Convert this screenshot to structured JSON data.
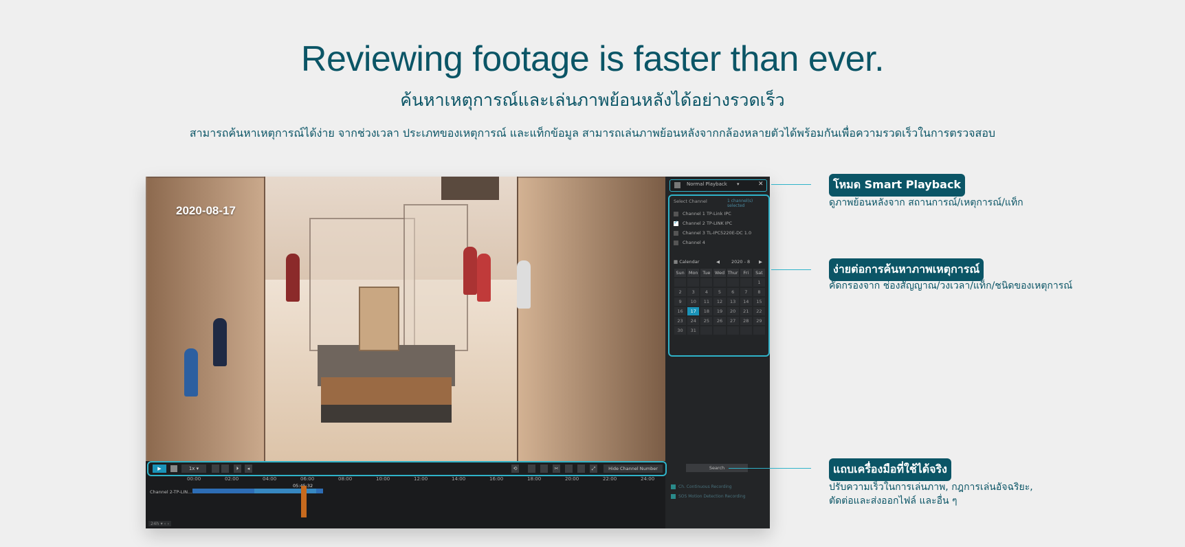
{
  "hero": {
    "title": "Reviewing footage is faster than ever.",
    "subtitle": "ค้นหาเหตุการณ์และเล่นภาพย้อนหลังได้อย่างรวดเร็ว",
    "description": "สามารถค้นหาเหตุการณ์ได้ง่าย จากช่วงเวลา ประเภทของเหตุการณ์ และแท็กข้อมูล สามารถเล่นภาพย้อนหลังจากกล้องหลายตัวได้พร้อมกันเพื่อความรวดเร็วในการตรวจสอบ"
  },
  "screenshot": {
    "video_date": "2020-08-17",
    "playback_mode": "Normal Playback",
    "channel_header": "Select Channel",
    "channel_count": "1 channel(s) selected",
    "channels": [
      {
        "label": "Channel 1 TP-Link IPC",
        "checked": false
      },
      {
        "label": "Channel 2 TP-LINK IPC",
        "checked": true
      },
      {
        "label": "Channel 3 TL-IPC5220E-DC 1.0",
        "checked": false
      },
      {
        "label": "Channel 4",
        "checked": false
      }
    ],
    "calendar_label": "Calendar",
    "calendar_month": "2020 - 8",
    "weekdays": [
      "Sun",
      "Mon",
      "Tue",
      "Wed",
      "Thur",
      "Fri",
      "Sat"
    ],
    "calendar_days": [
      "",
      "",
      "",
      "",
      "",
      "",
      "1",
      "2",
      "3",
      "4",
      "5",
      "6",
      "7",
      "8",
      "9",
      "10",
      "11",
      "12",
      "13",
      "14",
      "15",
      "16",
      "17",
      "18",
      "19",
      "20",
      "21",
      "22",
      "23",
      "24",
      "25",
      "26",
      "27",
      "28",
      "29",
      "30",
      "31",
      "",
      "",
      "",
      "",
      ""
    ],
    "selected_day": "17",
    "search_label": "Search",
    "options": [
      "Ch. Continuous Recording",
      "SOS Motion Detection Recording"
    ],
    "speed": "1x",
    "hide_channel_label": "Hide Channel Number",
    "timeline_ticks": [
      "00:00",
      "02:00",
      "04:00",
      "06:00",
      "08:00",
      "10:00",
      "12:00",
      "14:00",
      "16:00",
      "18:00",
      "20:00",
      "22:00",
      "24:00"
    ],
    "cursor_time": "05:45:32",
    "timeline_channel": "Channel 2-TP-LIN...",
    "timeline_scale": "24h"
  },
  "callouts": [
    {
      "tag": "โหมด Smart Playback",
      "text": "ดูภาพย้อนหลังจาก สถานการณ์/เหตุการณ์/แท็ก"
    },
    {
      "tag": "ง่ายต่อการค้นหาภาพเหตุการณ์",
      "text": "คัดกรองจาก ช่องสัญญาณ/วงเวลา/แท็ก/ชนิดของเหตุการณ์"
    },
    {
      "tag": "แถบเครื่องมือที่ใช้ได้จริง",
      "text": "ปรับความเร็วในการเล่นภาพ, กฎการเล่นอัจฉริยะ,",
      "text2": "ตัดต่อและส่งออกไฟล์ และอื่น ๆ"
    }
  ],
  "colors": {
    "accent": "#2fb3c9",
    "brand": "#0b5566",
    "selected": "#1a93b8"
  }
}
